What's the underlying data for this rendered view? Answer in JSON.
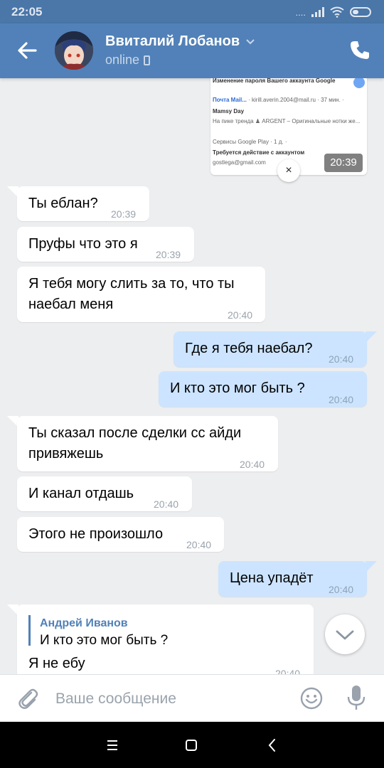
{
  "status_bar": {
    "time": "22:05",
    "dots": "...."
  },
  "header": {
    "contact_name": "Ввиталий Лобанов",
    "status": "online"
  },
  "image_card": {
    "line1": "Изменение пароля Вашего аккаунта Google",
    "line2a": "Почта Mail...",
    "line2b": "· kirill.averin.2004@mail.ru · 37 мин. ·",
    "line3": "Mamsy Day",
    "line4": "На пике тренда ♟ ARGENT – Оригинальные нотки же...",
    "line5": "Сервисы Google Play · 1 д. ·",
    "line6": "Требуется действие с аккаунтом",
    "line7": "gostlega@gmail.com",
    "time": "20:39",
    "close": "×"
  },
  "messages": [
    {
      "dir": "in",
      "text": "Ты еблан?",
      "time": "20:39"
    },
    {
      "dir": "in",
      "text": "Пруфы что это я",
      "time": "20:39"
    },
    {
      "dir": "in",
      "text": "Я тебя могу слить за то, что ты\nнаебал меня",
      "time": "20:40"
    },
    {
      "dir": "out",
      "text": "Где я тебя наебал?",
      "time": "20:40"
    },
    {
      "dir": "out",
      "text": "И кто это мог быть ?",
      "time": "20:40"
    },
    {
      "dir": "in",
      "text": "Ты сказал после сделки сс айди\nпривяжешь",
      "time": "20:40"
    },
    {
      "dir": "in",
      "text": "И канал отдашь",
      "time": "20:40"
    },
    {
      "dir": "in",
      "text": "Этого не произошло",
      "time": "20:40"
    },
    {
      "dir": "out",
      "text": "Цена упадёт",
      "time": "20:40"
    }
  ],
  "reply_message": {
    "reply_author": "Андрей Иванов",
    "reply_text": "И кто это мог быть ?",
    "text": "Я не ебу",
    "time": "20:40"
  },
  "composer": {
    "placeholder": "Ваше сообщение"
  },
  "colors": {
    "header": "#5181b8",
    "status_bar": "#4a76a8",
    "outgoing_bubble": "#cce4ff",
    "chat_bg": "#edeef0"
  },
  "icons": [
    "back-arrow-icon",
    "phone-icon",
    "attach-icon",
    "emoji-icon",
    "mic-icon",
    "chevron-down-icon",
    "menu-icon",
    "home-square-icon",
    "back-triangle-icon"
  ]
}
